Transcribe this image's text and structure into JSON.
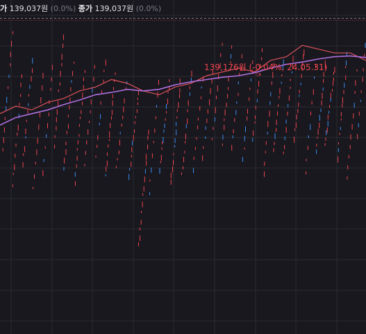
{
  "ohlc": {
    "prev_partial_label": "가",
    "prev_value": "139,037원",
    "prev_pct": "(0.0%)",
    "close_label": "종가",
    "close_value": "139,037원",
    "close_pct": "(0.0%)"
  },
  "annotation": {
    "high_text": "139,176원 (-0.04%, 24.05.31)",
    "marker_glyph": "◇"
  },
  "colors": {
    "background": "#18181e",
    "grid": "#2a2a32",
    "up": "#f0454f",
    "down": "#3d8ff5",
    "ma_red": "#e0525c",
    "ma_purple": "#b06fe0",
    "ref_line": "#d8d8dc"
  },
  "chart_data": {
    "type": "line",
    "title": "",
    "xlabel": "",
    "ylabel": "",
    "high": 139176,
    "current": 139037,
    "series": [
      {
        "values": [
          139050,
          139060,
          139055,
          139065,
          139070,
          139080,
          139085,
          139095,
          139090,
          139080,
          139075,
          139085,
          139090,
          139100,
          139105,
          139110,
          139105,
          139120,
          139125,
          139140,
          139135,
          139130,
          139130,
          139120
        ]
      },
      {
        "values": [
          139035,
          139045,
          139050,
          139055,
          139062,
          139068,
          139075,
          139078,
          139082,
          139080,
          139082,
          139088,
          139092,
          139095,
          139098,
          139100,
          139104,
          139110,
          139115,
          139118,
          139122,
          139125,
          139126,
          139124
        ]
      }
    ]
  }
}
